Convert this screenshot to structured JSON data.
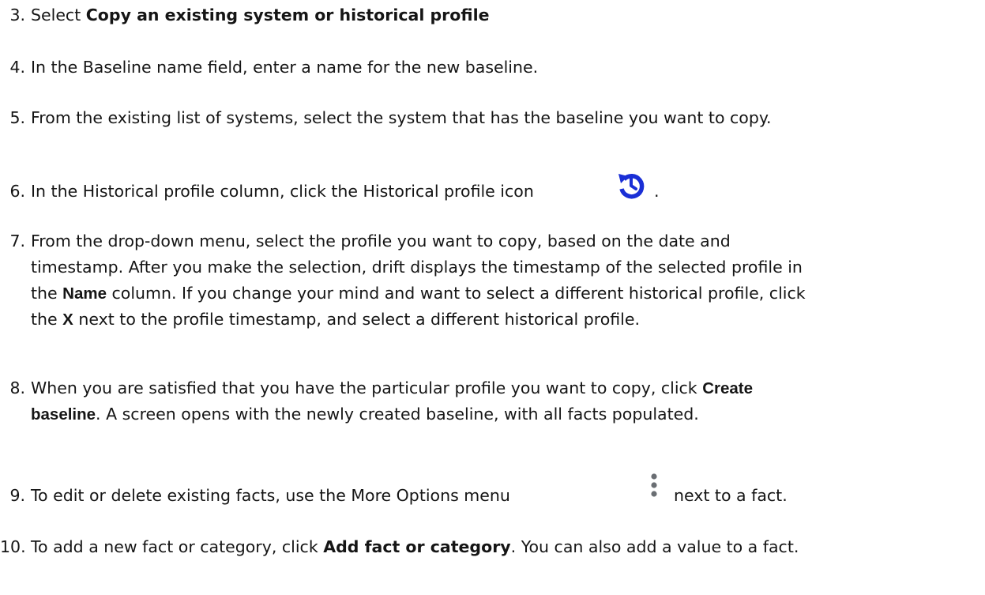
{
  "steps": [
    {
      "number": "3.",
      "parts": [
        "Select ",
        "Copy an existing system or historical profile"
      ]
    },
    {
      "number": "4.",
      "text": "In the Baseline name field, enter a name for the new baseline."
    },
    {
      "number": "5.",
      "text": "From the existing list of systems, select the system that has the baseline you want to copy."
    },
    {
      "number": "6.",
      "text": "In the Historical profile column, click the Historical profile icon",
      "after_icon": ".",
      "icon": "history-icon",
      "icon_color": "#1a2fd6"
    },
    {
      "number": "7.",
      "lines": [
        "From the drop-down menu, select the profile you want to copy, based on the date and",
        "timestamp. After you make the selection, drift displays the timestamp of the selected profile in"
      ],
      "line3": [
        "the ",
        "Name",
        " column. If you change your mind and want to select a different historical profile, click"
      ],
      "line4": [
        "the ",
        "X",
        " next to the profile timestamp, and select a different historical profile."
      ]
    },
    {
      "number": "8.",
      "line1": [
        "When you are satisfied that you have the particular profile you want to copy, click ",
        "Create"
      ],
      "line2": [
        "baseline",
        ". A screen opens with the newly created baseline, with all facts populated."
      ]
    },
    {
      "number": "9.",
      "text": "To edit or delete existing facts, use the More Options menu",
      "after_icon": "next to a fact.",
      "icon": "kebab-icon",
      "icon_color": "#6a6e73"
    },
    {
      "number": "10.",
      "parts": [
        "To add a new fact or category, click ",
        "Add fact or category",
        ". You can also add a value to a fact."
      ]
    }
  ]
}
